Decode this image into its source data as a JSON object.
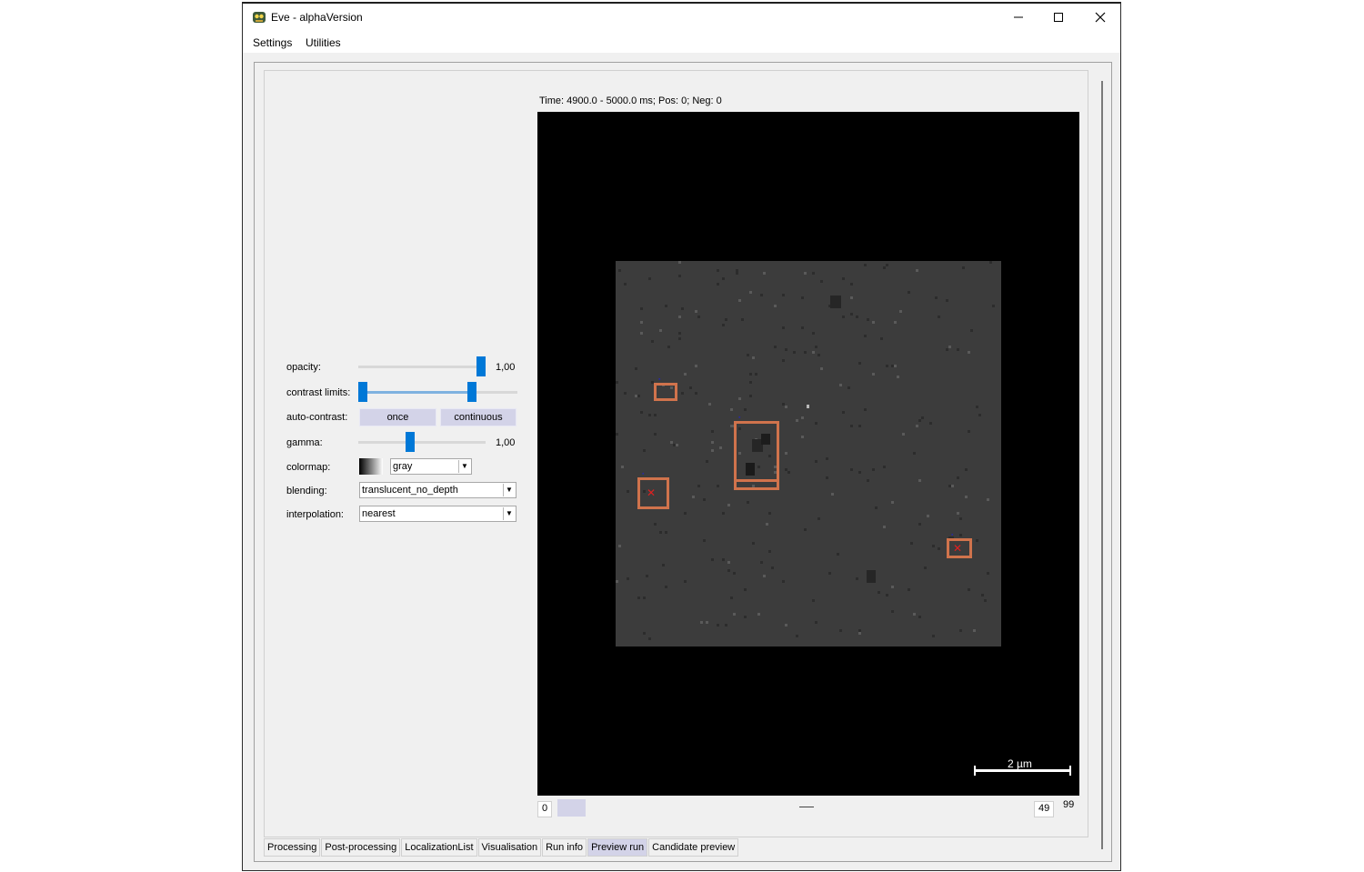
{
  "window": {
    "title": "Eve - alphaVersion",
    "controls": {
      "minimize": "minimize-icon",
      "maximize": "maximize-icon",
      "close": "close-icon"
    }
  },
  "menu": {
    "items": [
      "Settings",
      "Utilities"
    ]
  },
  "layer_controls": {
    "opacity": {
      "label": "opacity:",
      "value": "1,00",
      "level": 1.0
    },
    "contrast_limits": {
      "label": "contrast limits:",
      "low": 0.0,
      "high": 0.75
    },
    "auto_contrast": {
      "label": "auto-contrast:",
      "once": "once",
      "continuous": "continuous"
    },
    "gamma": {
      "label": "gamma:",
      "value": "1,00",
      "level": 0.4
    },
    "colormap": {
      "label": "colormap:",
      "value": "gray"
    },
    "blending": {
      "label": "blending:",
      "value": "translucent_no_depth"
    },
    "interpolation": {
      "label": "interpolation:",
      "value": "nearest"
    }
  },
  "viewer": {
    "time_status": "Time: 4900.0 - 5000.0 ms; Pos: 0; Neg: 0",
    "scale_bar": "2 µm"
  },
  "dims_slider": {
    "min": "0",
    "current": "49",
    "max": "99"
  },
  "tabs": {
    "items": [
      "Processing",
      "Post-processing",
      "LocalizationList",
      "Visualisation",
      "Run info",
      "Preview run",
      "Candidate preview"
    ],
    "active": "Preview run"
  },
  "colors": {
    "accent": "#0078d7",
    "bbox": "#d0734c",
    "active_tab": "#d3d3e8"
  }
}
